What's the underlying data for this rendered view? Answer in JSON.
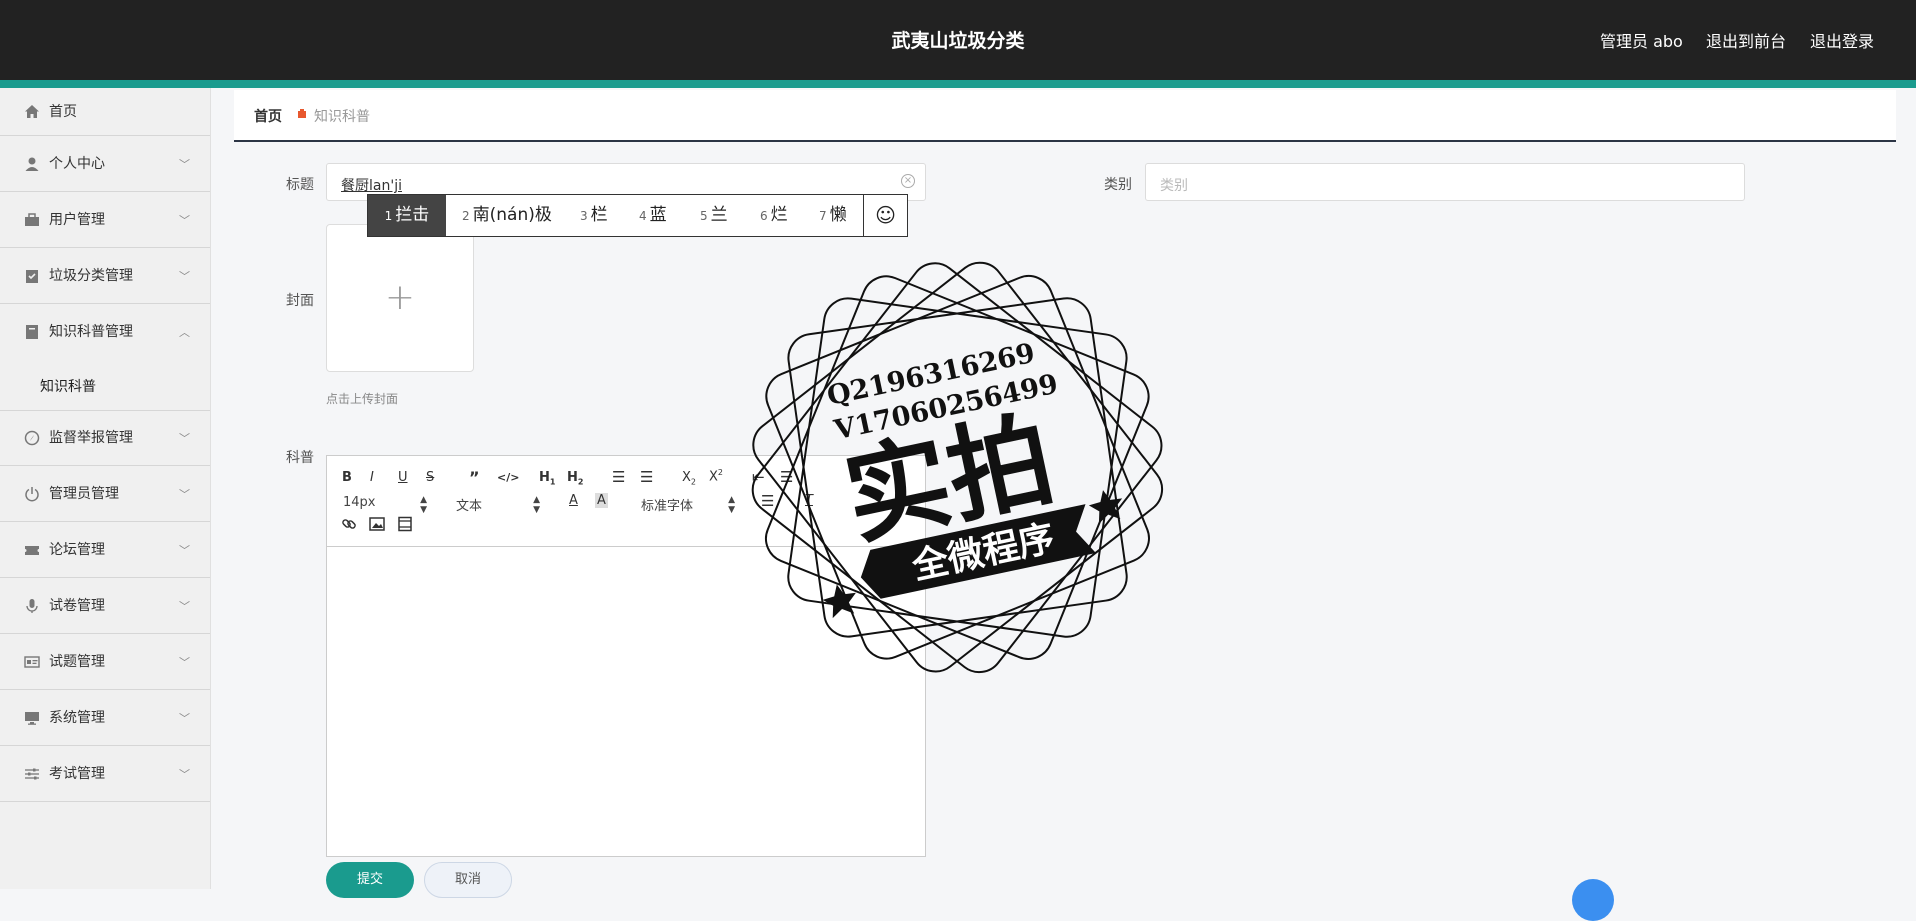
{
  "header": {
    "title": "武夷山垃圾分类",
    "user_label": "管理员 abo",
    "exit_front_label": "退出到前台",
    "logout_label": "退出登录"
  },
  "sidebar": {
    "items": [
      {
        "label": "首页",
        "icon": "home-icon"
      },
      {
        "label": "个人中心",
        "icon": "user-icon"
      },
      {
        "label": "用户管理",
        "icon": "briefcase-icon"
      },
      {
        "label": "垃圾分类管理",
        "icon": "clipboard-icon"
      },
      {
        "label": "知识科普管理",
        "icon": "book-icon"
      },
      {
        "label": "监督举报管理",
        "icon": "compass-icon"
      },
      {
        "label": "管理员管理",
        "icon": "power-icon"
      },
      {
        "label": "论坛管理",
        "icon": "ticket-icon"
      },
      {
        "label": "试卷管理",
        "icon": "mic-icon"
      },
      {
        "label": "试题管理",
        "icon": "id-card-icon"
      },
      {
        "label": "系统管理",
        "icon": "monitor-icon"
      },
      {
        "label": "考试管理",
        "icon": "sliders-icon"
      }
    ],
    "sub_items": [
      {
        "label": "知识科普"
      }
    ]
  },
  "breadcrumb": {
    "home": "首页",
    "current": "知识科普"
  },
  "form": {
    "title_label": "标题",
    "title_value": "餐厨lan'ji",
    "category_label": "类别",
    "category_placeholder": "类别",
    "cover_label": "封面",
    "cover_hint": "点击上传封面",
    "content_label": "科普",
    "font_size": "14px",
    "paragraph": "文本",
    "font_family": "标准字体",
    "submit_label": "提交",
    "cancel_label": "取消"
  },
  "ime": {
    "candidates": [
      {
        "n": "1",
        "text": "拦击"
      },
      {
        "n": "2",
        "text": "南(nán)极"
      },
      {
        "n": "3",
        "text": "栏"
      },
      {
        "n": "4",
        "text": "蓝"
      },
      {
        "n": "5",
        "text": "兰"
      },
      {
        "n": "6",
        "text": "烂"
      },
      {
        "n": "7",
        "text": "懒"
      }
    ],
    "emoji": "☺"
  },
  "watermark": {
    "line1": "Q2196316269",
    "line2": "V17060256499",
    "big": "实拍",
    "banner": "全微程序"
  },
  "colors": {
    "topbar": "#222222",
    "accent": "#1a9b8e",
    "breadcrumb_sep": "#e8582e"
  }
}
